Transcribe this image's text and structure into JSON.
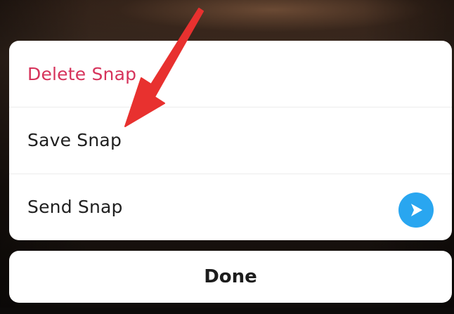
{
  "menu": {
    "delete_label": "Delete Snap",
    "save_label": "Save Snap",
    "send_label": "Send Snap"
  },
  "done_label": "Done",
  "icons": {
    "send": "send-arrow-icon",
    "annotation": "red-pointer-arrow"
  },
  "colors": {
    "delete_text": "#d6335b",
    "send_icon_bg": "#29a6f0",
    "annotation_arrow": "#e8312f"
  }
}
